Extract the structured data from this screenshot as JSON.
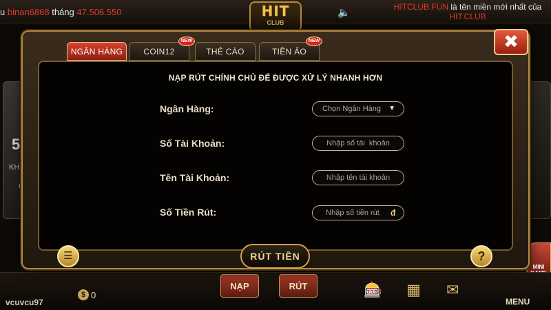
{
  "top_bar": {
    "ticker_prefix": "u",
    "ticker_user": "binan6868",
    "ticker_mid": "tháng",
    "ticker_amount": "47.506.550",
    "logo_text": "HIT",
    "logo_sub": "CLUB",
    "speaker_icon": "speaker-icon",
    "domain_red": "HITCLUB.FUN",
    "domain_white": "là tên miền mới nhất của",
    "domain_red2": "HIT.CLUB"
  },
  "background": {
    "left_card_big": "5",
    "left_card_text": "KH",
    "left_card_small": "C",
    "username": "vcuvcu97",
    "balance_currency": "$",
    "balance": "0",
    "button_deposit": "NẠP",
    "button_withdraw": "RÚT",
    "minigame_label": "MINI GAME",
    "menu_label": "MENU"
  },
  "dialog": {
    "tabs": [
      {
        "label": "NGÂN HÀNG",
        "active": true,
        "is_new": false
      },
      {
        "label": "COIN12",
        "active": false,
        "is_new": true
      },
      {
        "label": "THẺ CÀO",
        "active": false,
        "is_new": false
      },
      {
        "label": "TIỀN ẢO",
        "active": false,
        "is_new": true
      }
    ],
    "new_badge_text": "NEW",
    "close_symbol": "✖",
    "notice": "NẠP RÚT CHÍNH CHỦ ĐỂ ĐƯỢC XỬ LÝ NHANH HƠN",
    "form": {
      "bank_label": "Ngân Hàng:",
      "bank_select_value": "Chọn Ngân Hàng",
      "account_number_label": "Số Tài Khoản:",
      "account_number_placeholder": "Nhập số tài  khoản",
      "account_name_label": "Tên Tài Khoản:",
      "account_name_placeholder": "Nhập tên tài khoản",
      "amount_label": "Số Tiền Rút:",
      "amount_placeholder": "Nhập số tiền rút",
      "currency_symbol": "đ"
    },
    "submit_label": "RÚT TIỀN",
    "list_icon": "list-icon",
    "help_symbol": "?"
  },
  "colors": {
    "accent_gold": "#d4a24a",
    "tab_active_red": "#d54430",
    "ticker_red": "#e03a2a",
    "panel_bg": "#040302"
  }
}
